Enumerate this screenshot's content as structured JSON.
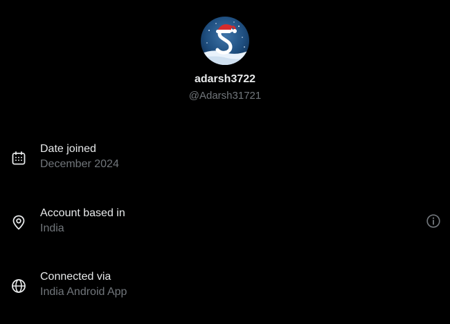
{
  "profile": {
    "display_name": "adarsh3722",
    "handle": "@Adarsh31721"
  },
  "about": {
    "rows": [
      {
        "label": "Date joined",
        "value": "December 2024",
        "icon": "calendar-icon"
      },
      {
        "label": "Account based in",
        "value": "India",
        "icon": "location-pin-icon",
        "action_icon": "info-icon"
      },
      {
        "label": "Connected via",
        "value": "India Android App",
        "icon": "globe-icon"
      }
    ]
  },
  "colors": {
    "background": "#000000",
    "primary_text": "#e7e9ea",
    "secondary_text": "#71767b"
  }
}
